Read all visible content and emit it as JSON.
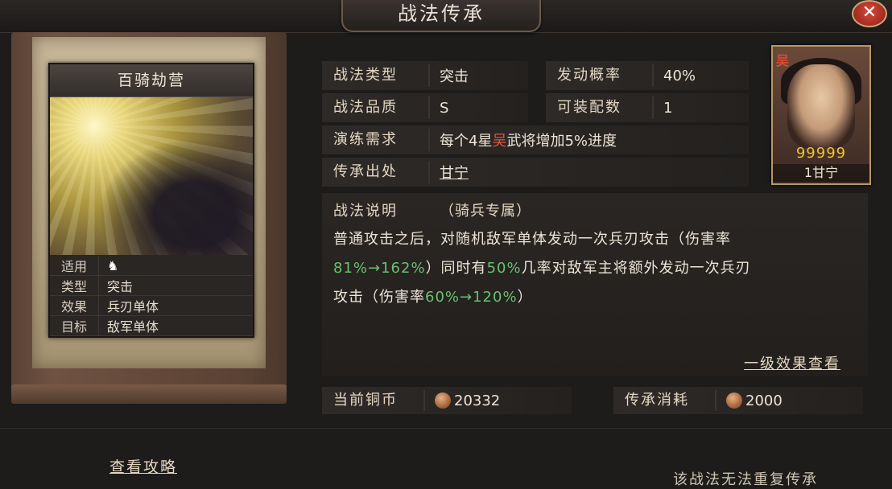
{
  "header": {
    "title": "战法传承",
    "close_label": "✕"
  },
  "card": {
    "name": "百骑劫营",
    "rows": [
      {
        "key": "适用",
        "value": ""
      },
      {
        "key": "类型",
        "value": "突击"
      },
      {
        "key": "效果",
        "value": "兵刃单体"
      },
      {
        "key": "目标",
        "value": "敌军单体"
      }
    ],
    "applicable_icon": "horse-icon"
  },
  "info": {
    "type_label": "战法类型",
    "type_value": "突击",
    "chance_label": "发动概率",
    "chance_value": "40%",
    "quality_label": "战法品质",
    "quality_value": "S",
    "slots_label": "可装配数",
    "slots_value": "1",
    "req_label": "演练需求",
    "req_prefix": "每个4星",
    "req_faction": "吴",
    "req_suffix": "武将增加5%进度",
    "source_label": "传承出处",
    "source_value": "甘宁"
  },
  "portrait": {
    "faction": "吴",
    "stars": "99999",
    "name": "1甘宁"
  },
  "description": {
    "head": "战法说明",
    "tag": "（骑兵专属）",
    "line1": "普通攻击之后，对随机敌军单体发动一次兵刃攻击（伤害率",
    "pct1": "81%→162%",
    "mid1": "）同时有",
    "pct2": "50%",
    "mid2": "几率对敌军主将额外发动一次兵刃",
    "line3a": "攻击（伤害率",
    "pct3": "60%→120%",
    "line3b": "）",
    "level_link": "一级效果查看"
  },
  "currency": {
    "current_label": "当前铜币",
    "current_value": "20332",
    "cost_label": "传承消耗",
    "cost_value": "2000"
  },
  "footer": {
    "guide": "查看攻略",
    "note": "该战法无法重复传承"
  },
  "colors": {
    "accent_red": "#e0543e",
    "accent_green": "#69c172",
    "source_orange": "#e07a3a"
  }
}
